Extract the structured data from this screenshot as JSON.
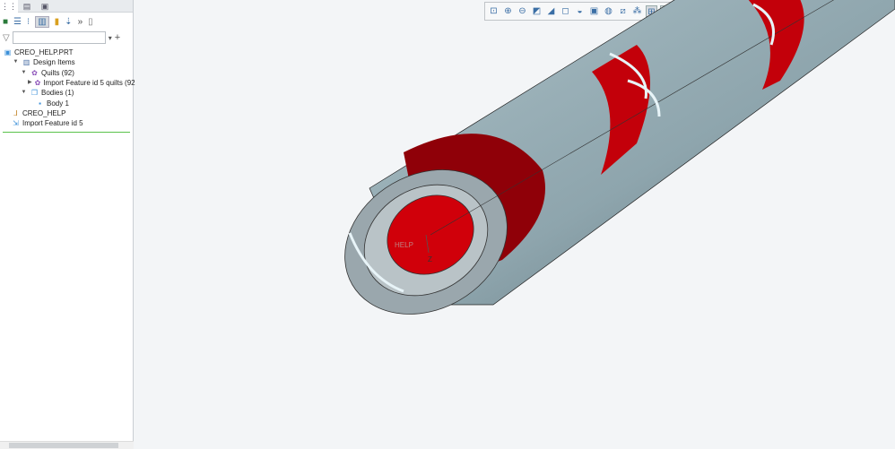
{
  "tabs": [
    "model-tree",
    "layers",
    "folder"
  ],
  "tree": {
    "filter_placeholder": "",
    "items": [
      {
        "label": "CREO_HELP.PRT",
        "icon": "part-icon",
        "indent": 0,
        "exp": ""
      },
      {
        "label": "Design Items",
        "icon": "design-items-icon",
        "indent": 1,
        "exp": "▼"
      },
      {
        "label": "Quilts (92)",
        "icon": "quilt-icon",
        "indent": 2,
        "exp": "▼"
      },
      {
        "label": "Import Feature id 5 quilts (92",
        "icon": "quilt-icon",
        "indent": 3,
        "exp": "▶"
      },
      {
        "label": "Bodies (1)",
        "icon": "bodies-icon",
        "indent": 2,
        "exp": "▼"
      },
      {
        "label": "Body 1",
        "icon": "body-icon",
        "indent": 4,
        "exp": ""
      },
      {
        "label": "CREO_HELP",
        "icon": "csys-icon",
        "indent": 1,
        "exp": ""
      },
      {
        "label": "Import Feature id 5",
        "icon": "import-feature-icon",
        "indent": 1,
        "exp": ""
      }
    ]
  },
  "viewport": {
    "csys_label": "HELP",
    "axis_label": "Z",
    "colors": {
      "tube": "#8ea5ad",
      "shade": "#5f737b",
      "red": "#d0000a"
    }
  }
}
